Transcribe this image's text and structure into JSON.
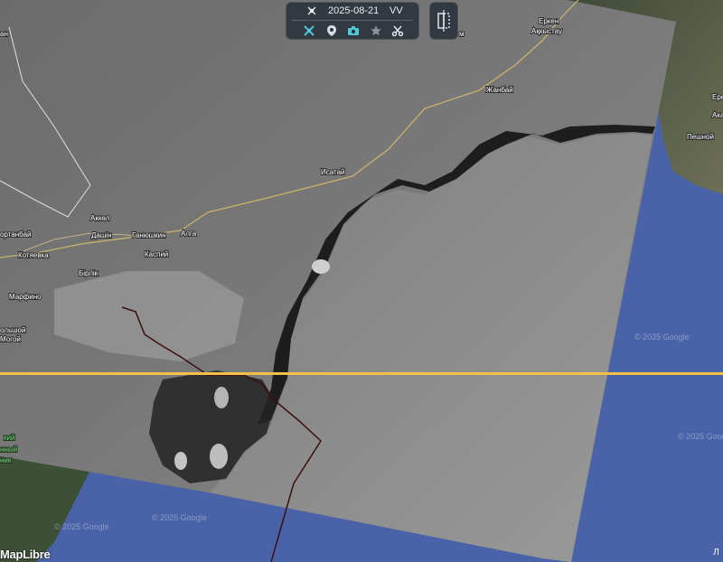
{
  "toolbar": {
    "date": "2025-08-21",
    "polarization": "VV",
    "icons": [
      "satellite-icon",
      "layers-icon",
      "camera-icon",
      "star-icon",
      "scissors-icon"
    ]
  },
  "map": {
    "attribution_logo": "MapLibre",
    "info_glyph": "Л",
    "watermarks": [
      "© 2025 Google",
      "© 2025 Google",
      "© 2025 Google",
      "© 2025 Google"
    ],
    "places": [
      {
        "name": "Еркен",
        "style": "white"
      },
      {
        "name": "Ақкыстау",
        "style": "white"
      },
      {
        "name": "Жанбай",
        "style": "white"
      },
      {
        "name": "Исатай",
        "style": "white"
      },
      {
        "name": "Аккөл",
        "style": "white"
      },
      {
        "name": "Дашін",
        "style": "white"
      },
      {
        "name": "Ганюшкин",
        "style": "white"
      },
      {
        "name": "Алга",
        "style": "white"
      },
      {
        "name": "Котяевка",
        "style": "white"
      },
      {
        "name": "Каспий",
        "style": "white"
      },
      {
        "name": "Бірлік",
        "style": "white"
      },
      {
        "name": "Марфино",
        "style": "white"
      },
      {
        "name": "ольшой",
        "style": "white"
      },
      {
        "name": "Могой",
        "style": "white"
      },
      {
        "name": "ортанбай",
        "style": "white"
      },
      {
        "name": "Пешной",
        "style": "white"
      },
      {
        "name": "Ере",
        "style": "white"
      },
      {
        "name": "Ака",
        "style": "white"
      },
      {
        "name": "ан",
        "style": "white"
      },
      {
        "name": "м",
        "style": "white"
      },
      {
        "name": "кий",
        "style": "green"
      },
      {
        "name": "нный",
        "style": "green"
      },
      {
        "name": "ник",
        "style": "green"
      }
    ]
  }
}
